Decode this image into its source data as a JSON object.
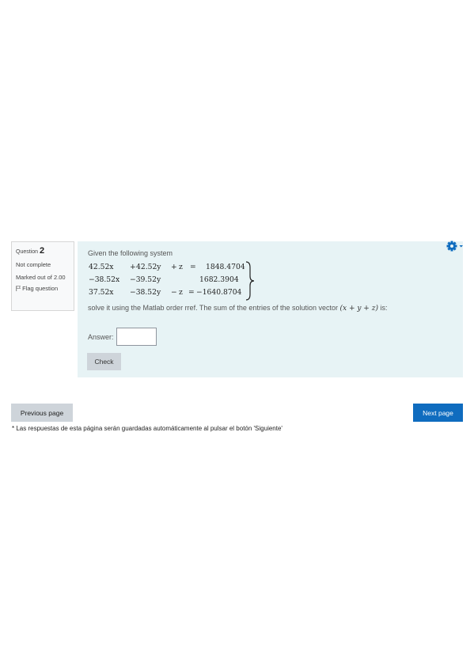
{
  "question_info": {
    "question_word": "Question",
    "number": "2",
    "state": "Not complete",
    "grade": "Marked out of 2.00",
    "flag_label": "Flag question"
  },
  "question": {
    "prompt": "Given the following system",
    "equations": [
      {
        "c1": "42.52x",
        "op1": "+",
        "c2": "42.52y",
        "op2": "+",
        "c3": "z",
        "eq": "=",
        "rhs": "1848.4704"
      },
      {
        "c1": "−38.52x",
        "op1": "",
        "c2": "−39.52y",
        "op2": "",
        "c3": "",
        "eq": "",
        "rhs": "1682.3904"
      },
      {
        "c1": "37.52x",
        "op1": "",
        "c2": "−38.52y",
        "op2": "−",
        "c3": "z",
        "eq": "=",
        "rhs": "−1640.8704"
      }
    ],
    "instruction_text": "solve it using the Matlab order rref. The sum of the entries of the solution vector",
    "instruction_math": "(x + y + z)",
    "instruction_end": "is:",
    "answer_label": "Answer:",
    "answer_value": "",
    "check_label": "Check"
  },
  "icons": {
    "gear": "gear-icon",
    "gear_caret": "caret-down-icon",
    "flag": "flag-icon"
  },
  "navigation": {
    "prev_label": "Previous page",
    "next_label": "Next page",
    "autosave_note": "* Las respuestas de esta página serán guardadas automáticamente al pulsar el botón 'Siguiente'"
  },
  "colors": {
    "content_bg": "#e7f3f5",
    "primary": "#0f6cbf",
    "secondary": "#ced4da"
  }
}
